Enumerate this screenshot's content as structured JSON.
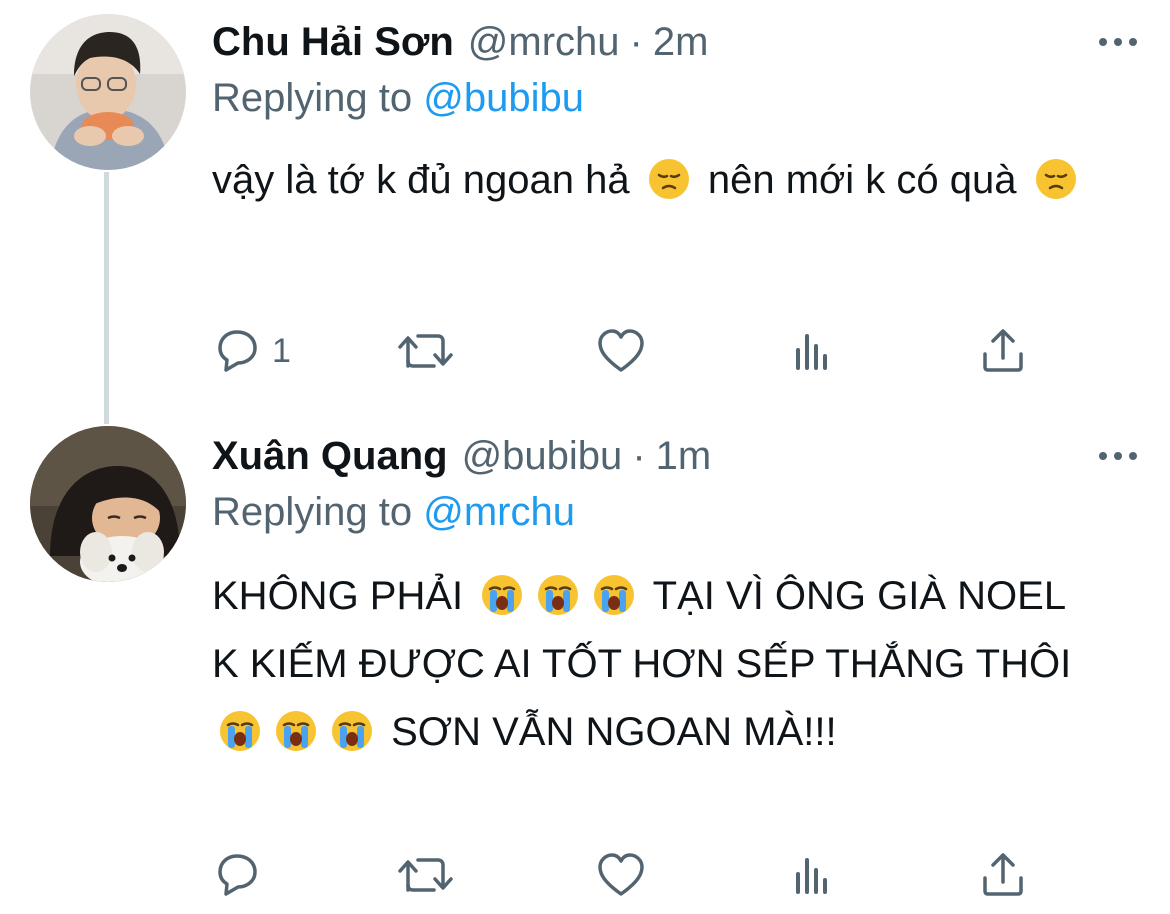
{
  "tweets": [
    {
      "display_name": "Chu Hải Sơn",
      "handle": "@mrchu",
      "separator": "·",
      "time": "2m",
      "replying_prefix": "Replying to",
      "replying_to": "@bubibu",
      "text_part1": "vậy là tớ k đủ ngoan hả",
      "text_part2": "nên mới k có quà",
      "reply_count": "1",
      "avatar_icon": "person-eating-photo",
      "inline_emoji": "disappointed-face"
    },
    {
      "display_name": "Xuân Quang",
      "handle": "@bubibu",
      "separator": "·",
      "time": "1m",
      "replying_prefix": "Replying to",
      "replying_to": "@mrchu",
      "text_part1": "KHÔNG PHẢI",
      "text_part2": "TẠI VÌ ÔNG GIÀ NOEL K KIẾM ĐƯỢC AI TỐT HƠN SẾP THẮNG THÔI",
      "text_part3": "SƠN VẪN NGOAN MÀ!!!",
      "reply_count": "",
      "avatar_icon": "person-with-dog-photo",
      "inline_emoji": "loudly-crying-face"
    }
  ],
  "colors": {
    "text_primary": "#0f1419",
    "text_secondary": "#536471",
    "mention_blue": "#1d9bf0",
    "thread_line": "#cfd9de",
    "emoji_yellow": "#f7c331",
    "emoji_tear_blue": "#4aa3f0"
  }
}
